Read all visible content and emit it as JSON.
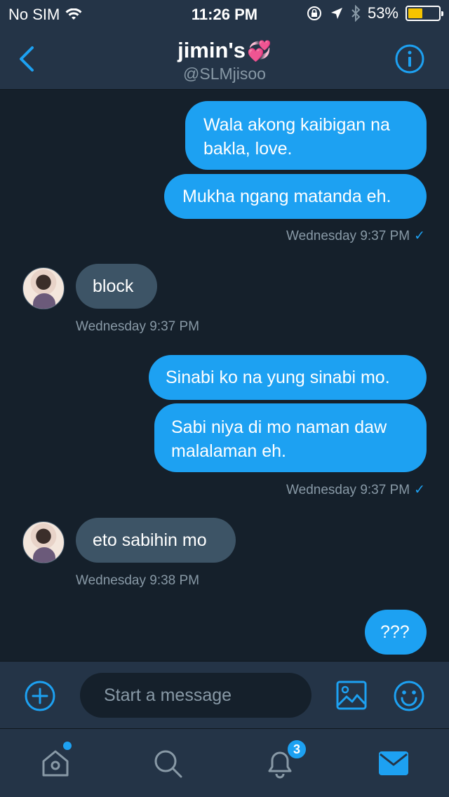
{
  "status_bar": {
    "carrier": "No SIM",
    "time": "11:26 PM",
    "battery": "53%",
    "battery_level": 0.53
  },
  "header": {
    "name": "jimin's",
    "name_emoji": "💞",
    "handle": "@SLMjisoo",
    "back_icon": "chevron-left-icon",
    "info_icon": "info-icon"
  },
  "messages": [
    {
      "dir": "out",
      "text": "Wala akong kaibigan na bakla, love."
    },
    {
      "dir": "out",
      "text": "Mukha ngang matanda eh."
    },
    {
      "dir": "out-ts",
      "text": "Wednesday 9:37 PM",
      "check": "✓"
    },
    {
      "dir": "in",
      "text": "block"
    },
    {
      "dir": "in-ts",
      "text": "Wednesday 9:37 PM"
    },
    {
      "dir": "out",
      "text": "Sinabi ko na yung sinabi mo."
    },
    {
      "dir": "out",
      "text": "Sabi niya di mo naman daw malalaman eh."
    },
    {
      "dir": "out-ts",
      "text": "Wednesday 9:37 PM",
      "check": "✓"
    },
    {
      "dir": "in",
      "text": "eto sabihin mo"
    },
    {
      "dir": "in-ts",
      "text": "Wednesday 9:38 PM"
    },
    {
      "dir": "out",
      "text": "???"
    }
  ],
  "composer": {
    "placeholder": "Start a message"
  },
  "tabbar": {
    "notifications_badge": "3"
  },
  "colors": {
    "accent": "#1da1f2",
    "background": "#15202b",
    "panel": "#243447",
    "incoming_bubble": "#3d5466",
    "muted": "#8899a6"
  }
}
